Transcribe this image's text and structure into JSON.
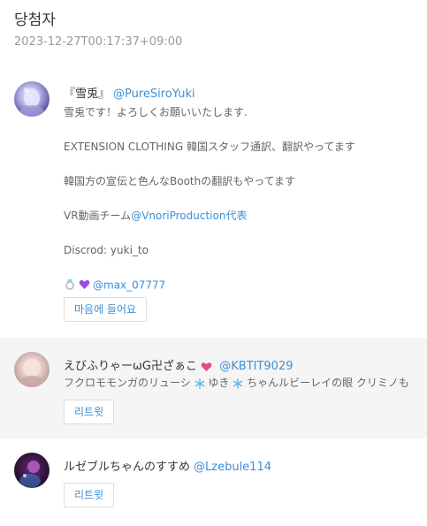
{
  "page": {
    "title": "당첨자",
    "timestamp": "2023-12-27T00:17:37+09:00"
  },
  "entries": [
    {
      "display_name": "『雪兎』",
      "handle": "@PureSiroYuki",
      "bio_lines": {
        "l1": "雪兎です！よろしくお願いいたします.",
        "l2": "EXTENSION CLOTHING 韓国スタッフ通訳、翻訳やってます",
        "l3": "韓国方の宣伝と色んなBoothの翻訳もやってます",
        "l4_prefix": "VR動画チーム",
        "l4_link": "@VnoriProduction代表",
        "l5": "Discrod: yuki_to",
        "l6_link": "@max_07777"
      },
      "icons": [
        "ring-icon",
        "purple-heart-icon"
      ],
      "button_label": "마음에 들어요"
    },
    {
      "display_name_part1": "えびふりゃーωG卍ざぁこ",
      "handle": "@KBTIT9029",
      "bio_parts": {
        "p1": "フクロモモンガのリューシ",
        "p2": "ゆき",
        "p3": "ちゃんルビーレイの眼 クリミノも"
      },
      "icons": [
        "pink-heart-icon",
        "snowflake-icon"
      ],
      "button_label": "리트윗"
    },
    {
      "display_name": "ルゼブルちゃんのすすめ",
      "handle": "@Lzebule114",
      "button_label": "리트윗"
    }
  ],
  "colors": {
    "link": "#3d8fd6",
    "muted": "#999999",
    "highlight_row": "#f5f5f5"
  }
}
